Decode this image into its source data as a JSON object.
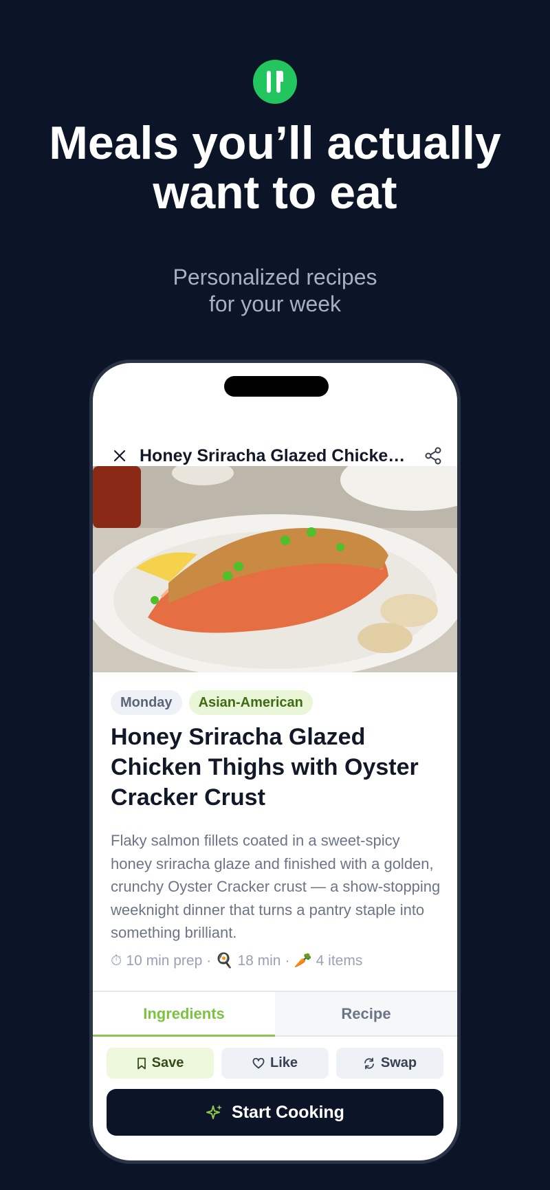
{
  "colors": {
    "background": "#0b1527",
    "brand_green": "#22c55e",
    "accent_lime": "#8cc64f"
  },
  "hero_text": {
    "logo_icon": "fork-knife-icon",
    "headline_line1": "Meals you’ll actually",
    "headline_line2": "want to eat",
    "subline_line1": "Personalized recipes",
    "subline_line2": "for your week"
  },
  "navbar": {
    "close_icon": "close-icon",
    "title": "Honey Sriracha Glazed Chicken Thighs with Oyster Cracker Crust",
    "share_icon": "share-icon"
  },
  "tags": {
    "day": "Monday",
    "cuisine": "Asian-American"
  },
  "recipe": {
    "title": "Honey Sriracha Glazed Chicken Thighs with Oyster Cracker Crust",
    "description": "Flaky salmon fillets coated in a sweet-spicy honey sriracha glaze and finished with a golden, crunchy Oyster Cracker crust — a show-stopping weeknight dinner that turns a pantry staple into something brilliant.",
    "prep": "10 min prep",
    "cook": "18 min",
    "items": "4 items",
    "separator": "·"
  },
  "tabs": {
    "ingredients": "Ingredients",
    "recipe": "Recipe"
  },
  "actions": {
    "save": "Save",
    "like": "Like",
    "swap": "Swap",
    "start_cooking": "Start Cooking"
  }
}
